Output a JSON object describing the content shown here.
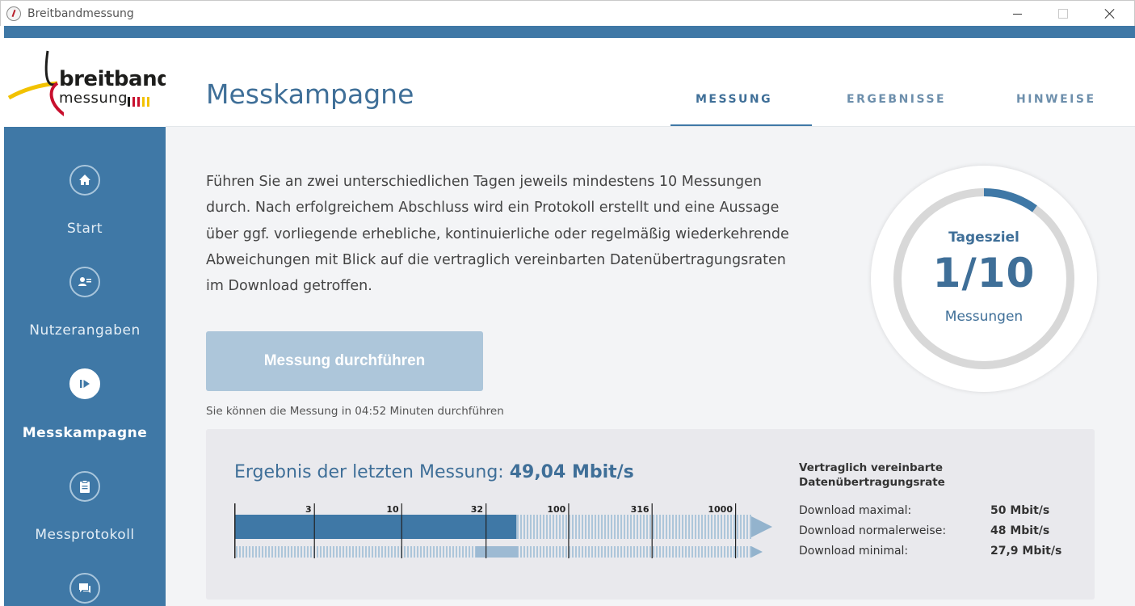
{
  "window": {
    "title": "Breitbandmessung"
  },
  "logo": {
    "line1": "breitband",
    "line2": "messung"
  },
  "sidebar": {
    "items": [
      {
        "label": "Start",
        "icon": "home-icon",
        "active": false
      },
      {
        "label": "Nutzerangaben",
        "icon": "user-card-icon",
        "active": false
      },
      {
        "label": "Messkampagne",
        "icon": "play-icon",
        "active": true
      },
      {
        "label": "Messprotokoll",
        "icon": "clipboard-icon",
        "active": false
      },
      {
        "label": "",
        "icon": "chat-icon",
        "active": false
      }
    ]
  },
  "header": {
    "title": "Messkampagne",
    "tabs": [
      {
        "label": "MESSUNG",
        "active": true
      },
      {
        "label": "ERGEBNISSE",
        "active": false
      },
      {
        "label": "HINWEISE",
        "active": false
      }
    ]
  },
  "main": {
    "description": "Führen Sie an zwei unterschiedlichen Tagen jeweils mindestens 10 Messungen durch. Nach erfolgreichem Abschluss wird ein Protokoll erstellt und eine Aussage über ggf. vorliegende erhebliche, kontinuierliche oder regelmäßig wiederkehrende Abweichungen mit Blick auf die vertraglich vereinbarten Datenübertragungsraten im Download getroffen.",
    "button_label": "Messung durchführen",
    "hint": "Sie können die Messung in 04:52 Minuten durchführen"
  },
  "gauge": {
    "label_top": "Tagesziel",
    "value": "1/10",
    "label_bottom": "Messungen",
    "progress": 0.1
  },
  "result": {
    "title_prefix": "Ergebnis der letzten Messung:",
    "title_value": "49,04 Mbit/s",
    "scale_ticks": [
      "3",
      "10",
      "32",
      "100",
      "316",
      "1000"
    ],
    "measured_mbit": 49.04,
    "contract": {
      "max": 50,
      "normal": 48,
      "min": 27.9
    },
    "right_heading_1": "Vertraglich vereinbarte",
    "right_heading_2": "Datenübertragungsrate",
    "rows": [
      {
        "label": "Download maximal:",
        "value": "50 Mbit/s"
      },
      {
        "label": "Download normalerweise:",
        "value": "48 Mbit/s"
      },
      {
        "label": "Download minimal:",
        "value": "27,9 Mbit/s"
      }
    ]
  },
  "colors": {
    "primary": "#3f78a6",
    "button": "#adc6da",
    "text_blue": "#3f6f98"
  }
}
